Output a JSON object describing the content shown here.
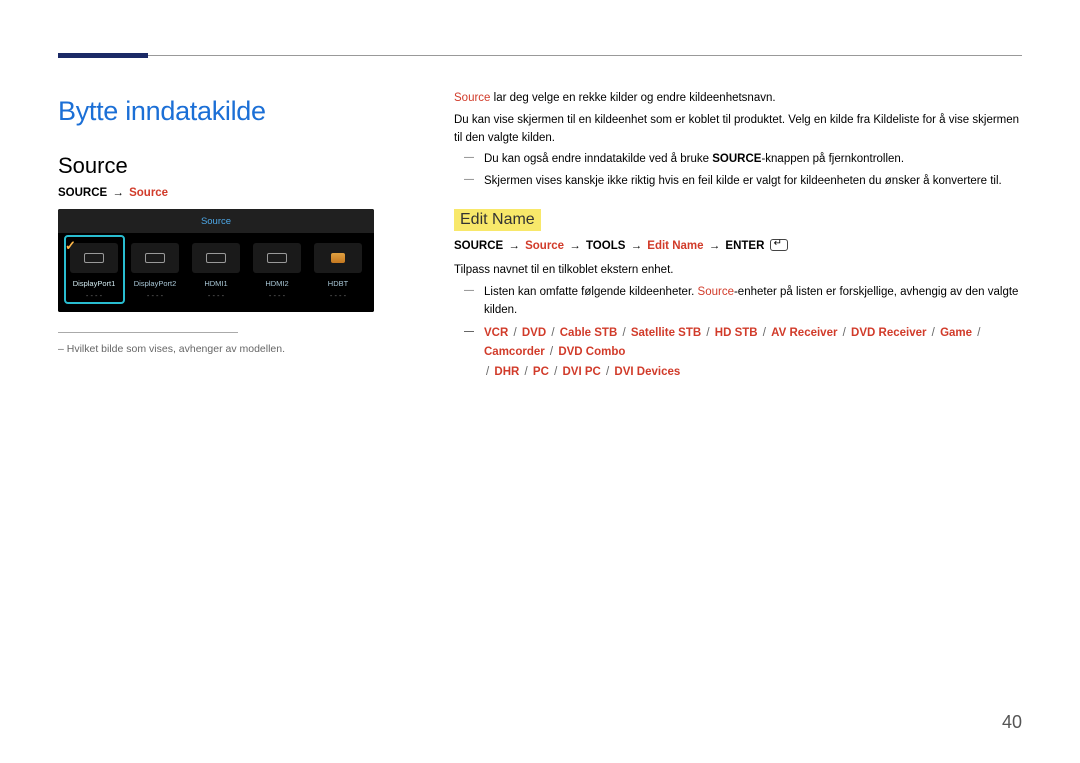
{
  "chapter_title": "Bytte inndatakilde",
  "section_title": "Source",
  "source_path": {
    "a": "SOURCE",
    "b": "Source"
  },
  "mockup": {
    "title": "Source",
    "items": [
      {
        "label": "DisplayPort1",
        "sub": "- - - -"
      },
      {
        "label": "DisplayPort2",
        "sub": "- - - -"
      },
      {
        "label": "HDMI1",
        "sub": "- - - -"
      },
      {
        "label": "HDMI2",
        "sub": "- - - -"
      },
      {
        "label": "HDBT",
        "sub": "- - - -"
      }
    ]
  },
  "footnote_intro": "– Hvilket bilde som vises, avhenger av modellen.",
  "body": {
    "p1_red": "Source",
    "p1_rest": " lar deg velge en rekke kilder og endre kildeenhetsnavn.",
    "p2": "Du kan vise skjermen til en kildeenhet som er koblet til produktet. Velg en kilde fra Kildeliste for å vise skjermen til den valgte kilden.",
    "d1a": "Du kan også endre inndatakilde ved å bruke ",
    "d1b": "SOURCE",
    "d1c": "-knappen på fjernkontrollen.",
    "d2": "Skjermen vises kanskje ikke riktig hvis en feil kilde er valgt for kildeenheten du ønsker å konvertere til."
  },
  "editname": {
    "heading": "Edit Name",
    "path": {
      "a": "SOURCE",
      "b": "Source",
      "c": "TOOLS",
      "d": "Edit Name",
      "e": "ENTER"
    },
    "p1": "Tilpass navnet til en tilkoblet ekstern enhet.",
    "d1a": "Listen kan omfatte følgende kildeenheter. ",
    "d1b": "Source",
    "d1c": "-enheter på listen er forskjellige, avhengig av den valgte kilden.",
    "devices": [
      "VCR",
      "DVD",
      "Cable STB",
      "Satellite STB",
      "HD STB",
      "AV Receiver",
      "DVD Receiver",
      "Game",
      "Camcorder",
      "DVD Combo",
      "DHR",
      "PC",
      "DVI PC",
      "DVI Devices"
    ]
  },
  "page_number": "40"
}
